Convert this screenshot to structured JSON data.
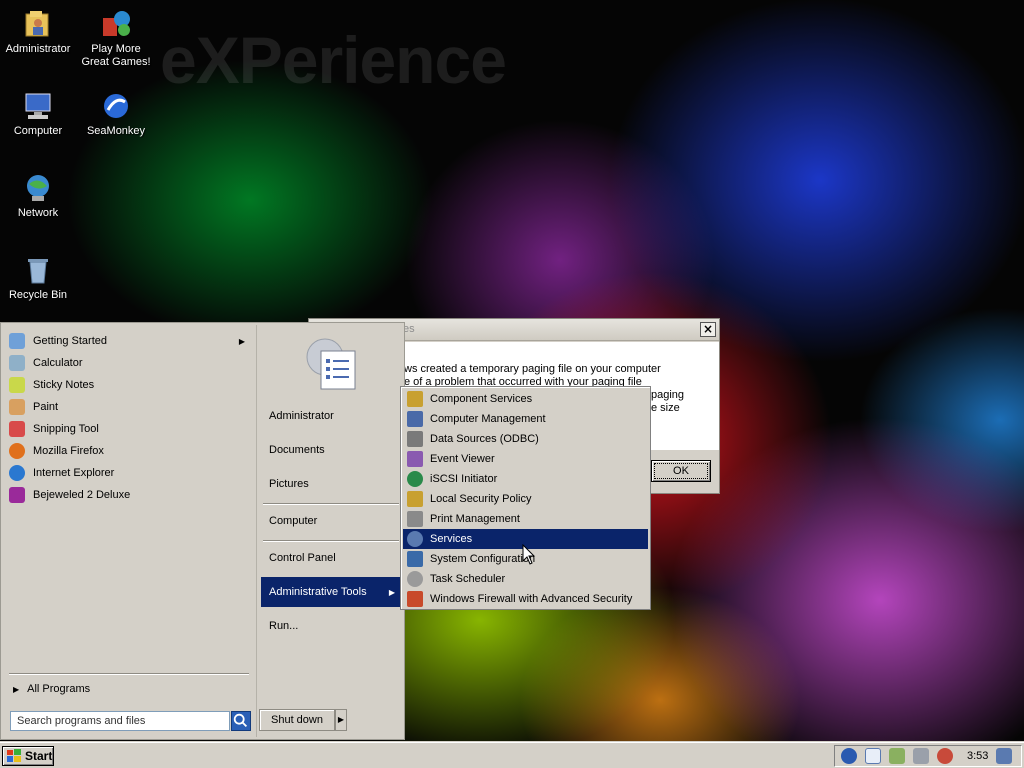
{
  "wallpaper": {
    "watermark": "eXPerience"
  },
  "desktop_icons": [
    {
      "label": "Administrator",
      "icon": "folder-user-icon"
    },
    {
      "label": "Play More Great Games!",
      "icon": "games-icon"
    },
    {
      "label": "Computer",
      "icon": "computer-icon"
    },
    {
      "label": "SeaMonkey",
      "icon": "seamonkey-icon"
    },
    {
      "label": "Network",
      "icon": "network-icon"
    },
    {
      "label": "Recycle Bin",
      "icon": "recycle-bin-icon"
    }
  ],
  "dialog": {
    "title_fragment": "es",
    "close": "×",
    "message_line1": "ws created a temporary paging file on your computer",
    "message_line2": "e of a problem that occurred with your paging file",
    "message_right1": "paging",
    "message_right2": "e size",
    "ok": "OK"
  },
  "start_menu": {
    "programs": [
      {
        "label": "Getting Started",
        "icon": "getting-started-icon",
        "color": "#6fa0d8",
        "submenu": true
      },
      {
        "label": "Calculator",
        "icon": "calculator-icon",
        "color": "#8fb0c8"
      },
      {
        "label": "Sticky Notes",
        "icon": "sticky-notes-icon",
        "color": "#c9d84a"
      },
      {
        "label": "Paint",
        "icon": "paint-icon",
        "color": "#d8a060"
      },
      {
        "label": "Snipping Tool",
        "icon": "snipping-tool-icon",
        "color": "#d84a4a"
      },
      {
        "label": "Mozilla Firefox",
        "icon": "firefox-icon",
        "color": "#e0701c"
      },
      {
        "label": "Internet Explorer",
        "icon": "internet-explorer-icon",
        "color": "#2a78d0"
      },
      {
        "label": "Bejeweled 2 Deluxe",
        "icon": "bejeweled-icon",
        "color": "#9a2a9a"
      }
    ],
    "all_programs": "All Programs",
    "search_placeholder": "Search programs and files",
    "right_items": [
      {
        "label": "Administrator"
      },
      {
        "label": "Documents"
      },
      {
        "label": "Pictures"
      },
      {
        "label": "Computer"
      },
      {
        "label": "Control Panel"
      },
      {
        "label": "Administrative Tools",
        "submenu": true,
        "active": true
      },
      {
        "label": "Run..."
      }
    ],
    "shutdown": "Shut down"
  },
  "admin_tools_submenu": [
    {
      "label": "Component Services",
      "icon": "component-services-icon",
      "color": "#c8a030"
    },
    {
      "label": "Computer Management",
      "icon": "computer-management-icon",
      "color": "#4a6aa8"
    },
    {
      "label": "Data Sources (ODBC)",
      "icon": "odbc-icon",
      "color": "#7a7a7a"
    },
    {
      "label": "Event Viewer",
      "icon": "event-viewer-icon",
      "color": "#8a5ab0"
    },
    {
      "label": "iSCSI Initiator",
      "icon": "iscsi-icon",
      "color": "#2a8a4a"
    },
    {
      "label": "Local Security Policy",
      "icon": "security-policy-icon",
      "color": "#c8a030"
    },
    {
      "label": "Print Management",
      "icon": "print-management-icon",
      "color": "#8a8a8a"
    },
    {
      "label": "Services",
      "icon": "services-gear-icon",
      "color": "#5a7ab0",
      "active": true
    },
    {
      "label": "System Configuration",
      "icon": "system-config-icon",
      "color": "#3a6aa8"
    },
    {
      "label": "Task Scheduler",
      "icon": "task-scheduler-icon",
      "color": "#9a9a9a"
    },
    {
      "label": "Windows Firewall with Advanced Security",
      "icon": "firewall-icon",
      "color": "#c84a2a"
    }
  ],
  "taskbar": {
    "start": "Start",
    "clock": "3:53",
    "tray_icons": [
      "seamonkey-tray-icon",
      "document-tray-icon",
      "network-tray-icon",
      "monitor-tray-icon",
      "volume-muted-icon"
    ]
  }
}
